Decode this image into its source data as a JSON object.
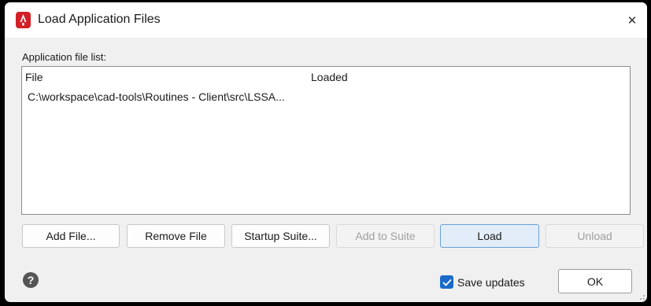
{
  "window": {
    "title": "Load Application Files",
    "app_icon": "autocad-red-a-icon",
    "close_glyph": "✕"
  },
  "list": {
    "label": "Application file list:",
    "columns": {
      "file": "File",
      "loaded": "Loaded"
    },
    "rows": [
      {
        "file": "C:\\workspace\\cad-tools\\Routines - Client\\src\\LSSA...",
        "loaded": ""
      }
    ]
  },
  "buttons": {
    "add_file": "Add File...",
    "remove_file": "Remove File",
    "startup_suite": "Startup Suite...",
    "add_to_suite": "Add to Suite",
    "load": "Load",
    "unload": "Unload"
  },
  "footer": {
    "help_glyph": "?",
    "save_updates_label": "Save updates",
    "save_updates_checked": true,
    "ok_label": "OK"
  },
  "colors": {
    "app_icon_red": "#d32027",
    "checkbox_blue": "#1b6ac9",
    "primary_button_bg": "#e2edf9"
  }
}
